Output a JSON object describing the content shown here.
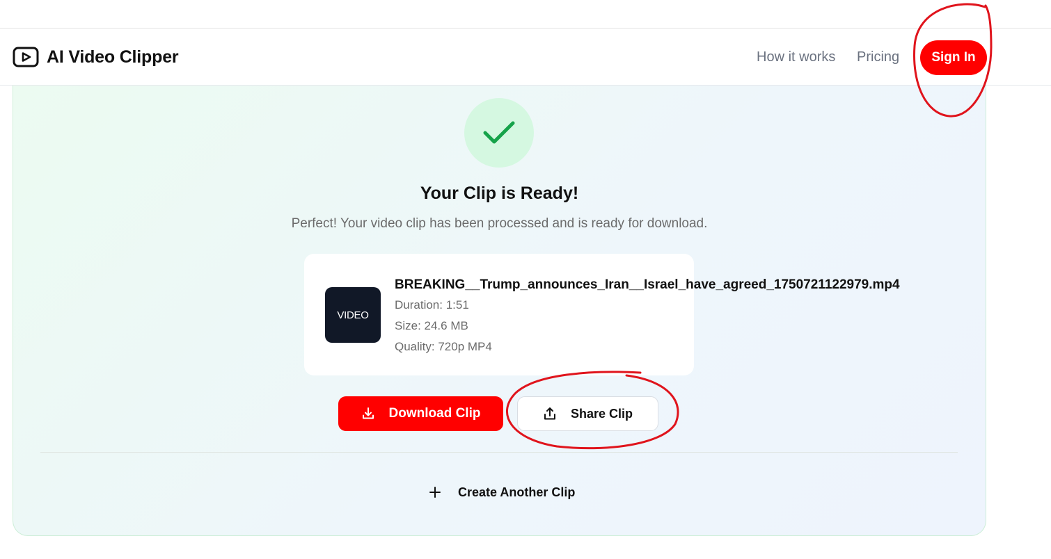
{
  "app": {
    "name": "AI Video Clipper"
  },
  "nav": {
    "how_it_works": "How it works",
    "pricing": "Pricing",
    "sign_in": "Sign In"
  },
  "result": {
    "heading": "Your Clip is Ready!",
    "subtext": "Perfect! Your video clip has been processed and is ready for download.",
    "thumbnail_label": "VIDEO",
    "filename": "BREAKING__Trump_announces_Iran__Israel_have_agreed_1750721122979.mp4",
    "duration": "Duration: 1:51",
    "size": "Size: 24.6 MB",
    "quality": "Quality: 720p MP4"
  },
  "actions": {
    "download": "Download Clip",
    "share": "Share Clip",
    "create_another": "Create Another Clip"
  },
  "icons": {
    "brand": "play-square-icon",
    "success": "checkmark-icon",
    "download": "download-icon",
    "share": "share-icon",
    "create": "plus-icon"
  },
  "colors": {
    "accent": "#ff0000",
    "success": "#16a34a",
    "success_bg": "#d5f8e1",
    "annotation": "#e0141c"
  }
}
